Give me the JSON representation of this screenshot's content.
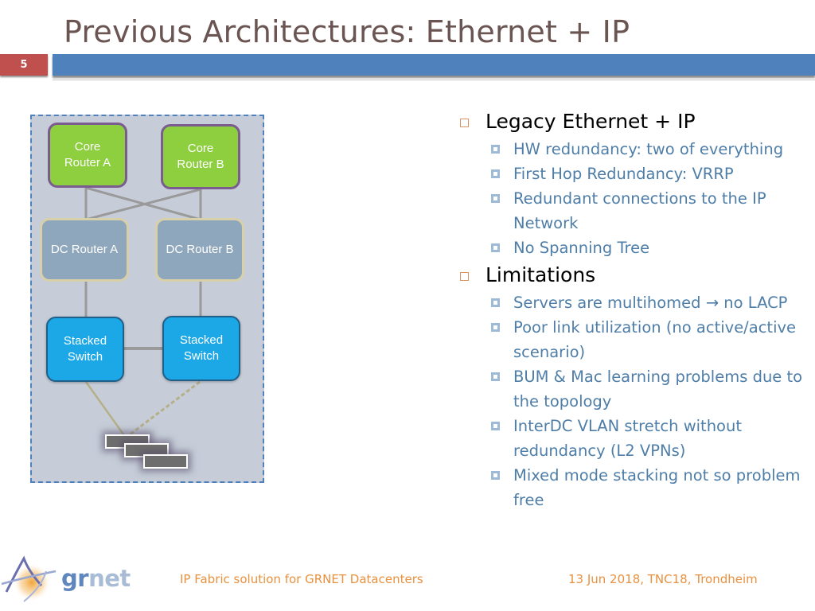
{
  "slide": {
    "title": "Previous Architectures: Ethernet + IP",
    "number": "5"
  },
  "diagram": {
    "core_routers": [
      {
        "label": "Core Router A"
      },
      {
        "label": "Core Router B"
      }
    ],
    "dc_routers": [
      {
        "label": "DC Router A"
      },
      {
        "label": "DC Router B"
      }
    ],
    "switches": [
      {
        "label": "Stacked Switch"
      },
      {
        "label": "Stacked Switch"
      }
    ],
    "colors": {
      "core": "#8dcf3f",
      "dc": "#8ea7bd",
      "switch": "#1ca8e6",
      "background": "#c6cdd8",
      "border": "#4f81bd"
    }
  },
  "content": {
    "sections": [
      {
        "heading": "Legacy Ethernet + IP",
        "items": [
          "HW redundancy: two of everything",
          "First Hop Redundancy: VRRP",
          "Redundant connections to the IP Network",
          "No Spanning Tree"
        ]
      },
      {
        "heading": "Limitations",
        "items": [
          "Servers are multihomed → no LACP",
          "Poor link utilization (no active/active scenario)",
          "BUM & Mac learning problems due to the topology",
          "InterDC VLAN stretch without redundancy (L2 VPNs)",
          "Mixed mode stacking not so problem free"
        ]
      }
    ]
  },
  "footer": {
    "left": "IP Fabric solution for GRNET Datacenters",
    "right": "13 Jun 2018, TNC18, Trondheim",
    "logo_text_a": "gr",
    "logo_text_b": "net"
  }
}
